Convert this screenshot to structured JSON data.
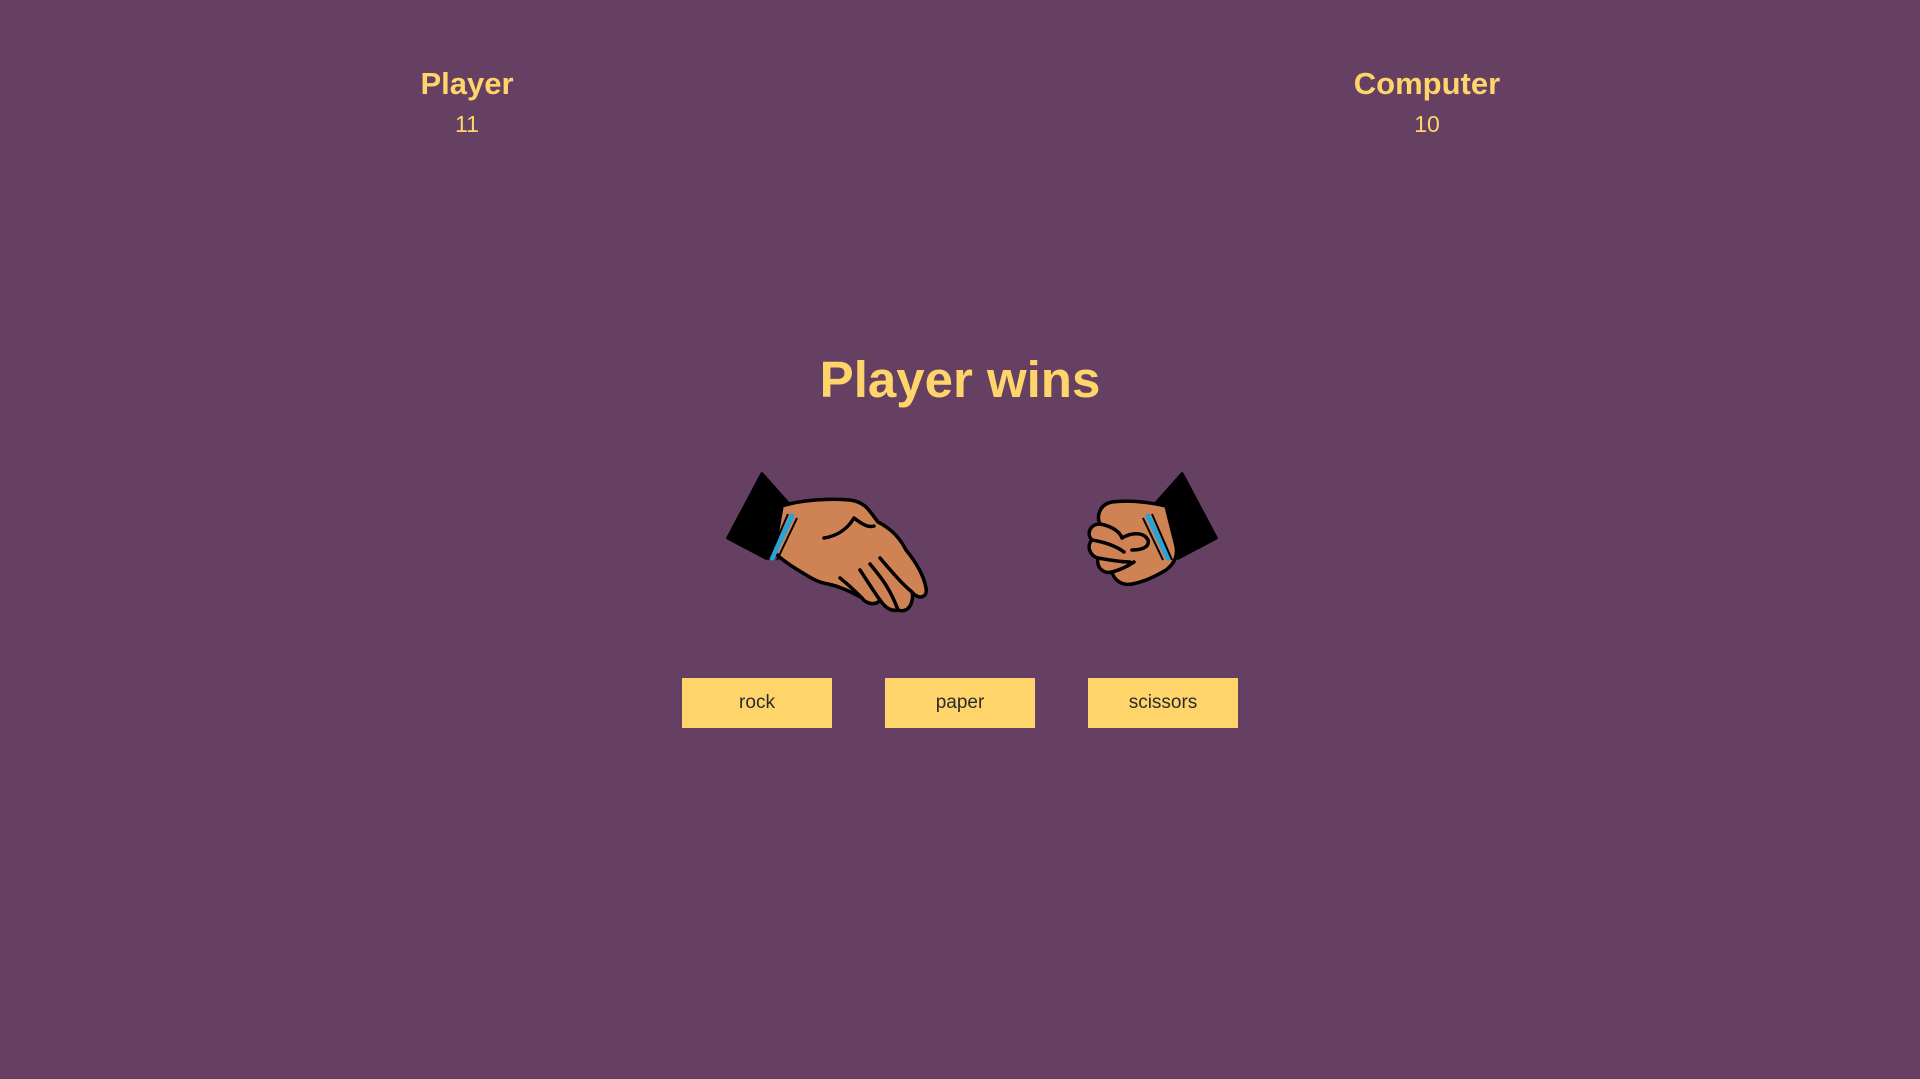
{
  "scoreboard": {
    "player": {
      "label": "Player",
      "score": "11"
    },
    "computer": {
      "label": "Computer",
      "score": "10"
    }
  },
  "result": "Player wins",
  "hands": {
    "player": "paper-hand-icon",
    "computer": "rock-hand-icon"
  },
  "choices": [
    "rock",
    "paper",
    "scissors"
  ],
  "colors": {
    "background": "#654062",
    "accent": "#ffd56b",
    "skin": "#cf8354",
    "sleeve": "#000000",
    "cuff": "#29a3d6"
  }
}
